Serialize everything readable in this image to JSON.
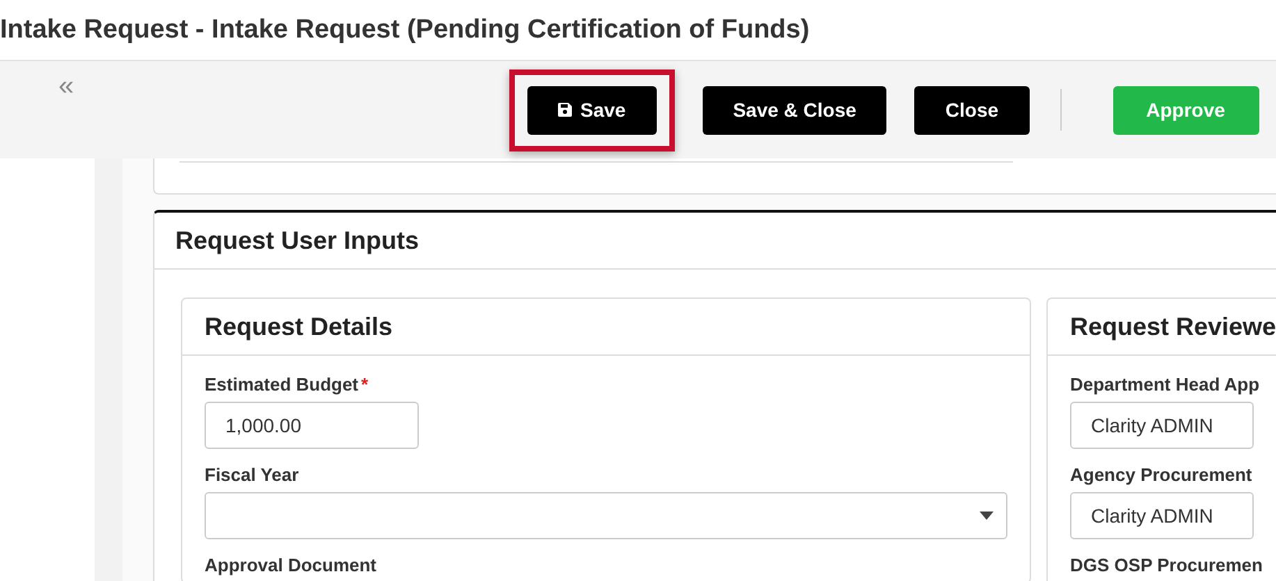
{
  "window": {
    "title": "Intake Request - Intake Request (Pending Certification of Funds)"
  },
  "toolbar": {
    "collapse": "«",
    "buttons": [
      {
        "label": "Save",
        "kind": "dark",
        "highlighted": true
      },
      {
        "label": "Save & Close",
        "kind": "dark",
        "highlighted": false
      },
      {
        "label": "Close",
        "kind": "dark",
        "highlighted": false
      },
      {
        "label": "Approve",
        "kind": "success",
        "highlighted": false
      }
    ]
  },
  "section": {
    "title": "Request User Inputs",
    "cards": [
      {
        "title": "Request Details",
        "fields": [
          {
            "label": "Estimated Budget",
            "marker": "*",
            "kind": "number",
            "value": "1,000.00"
          },
          {
            "label": "Fiscal Year",
            "kind": "select"
          },
          {
            "label": "Approval Document",
            "kind": "none"
          }
        ]
      },
      {
        "title": "Request Reviewe",
        "fields": [
          {
            "label": "Department Head App",
            "kind": "text",
            "value": "Clarity ADMIN"
          },
          {
            "label": "Agency Procurement",
            "kind": "text",
            "value": "Clarity ADMIN"
          },
          {
            "label": "DGS OSP Procuremen",
            "kind": "none"
          }
        ]
      }
    ]
  }
}
